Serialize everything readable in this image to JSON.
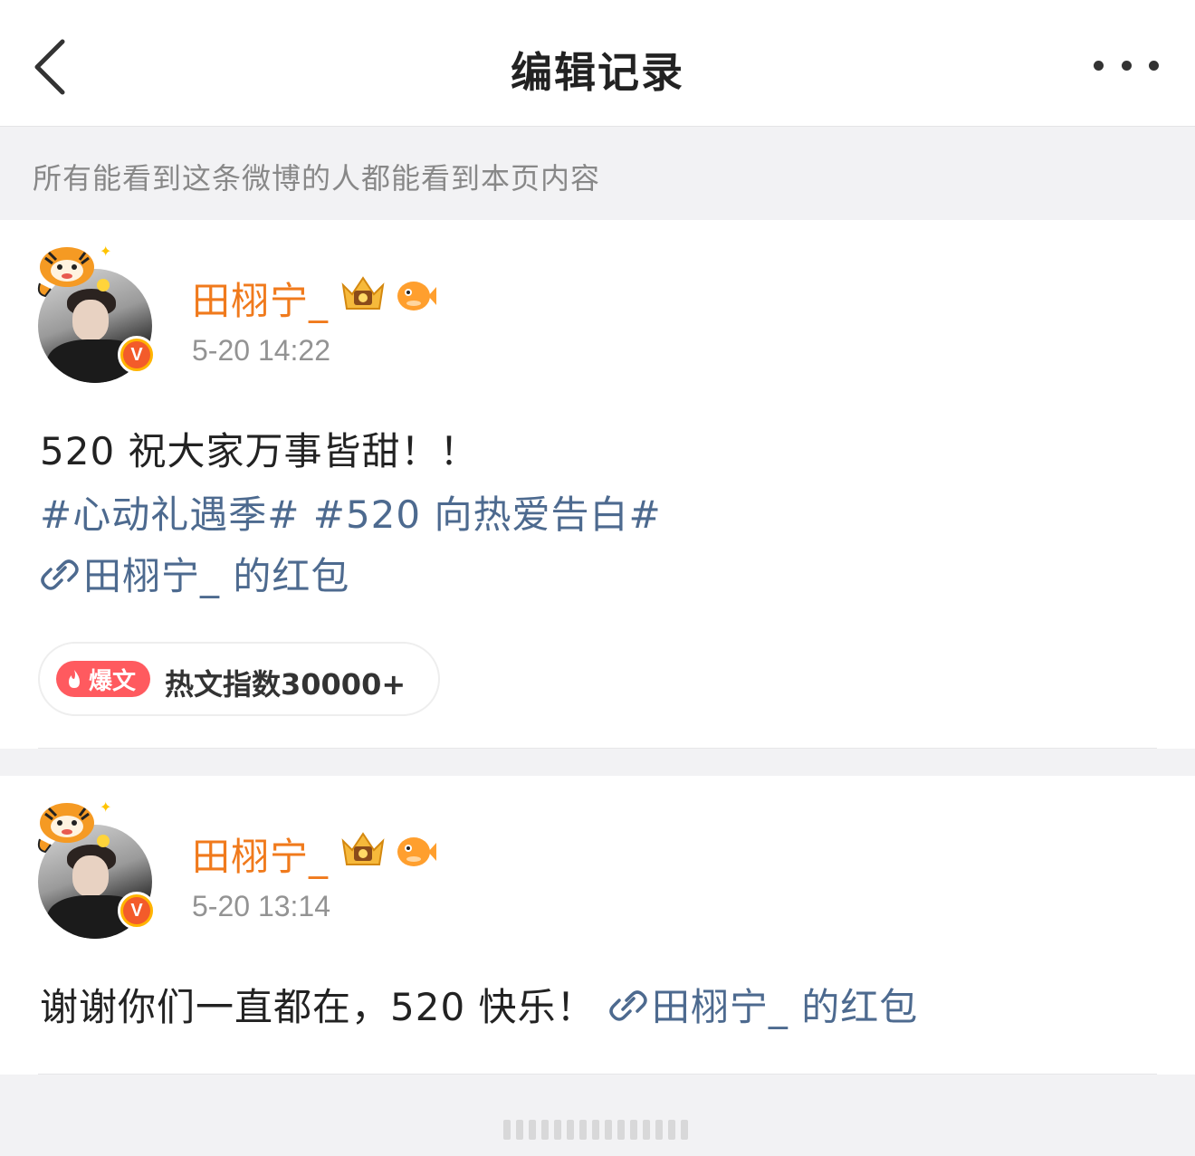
{
  "header": {
    "title": "编辑记录",
    "back_icon": "chevron-left-icon",
    "more_icon": "more-dots-icon"
  },
  "notice": "所有能看到这条微博的人都能看到本页内容",
  "posts": [
    {
      "username": "田栩宁_",
      "timestamp": "5-20 14:22",
      "line1": "520 祝大家万事皆甜！！",
      "hashtag1": "#心动礼遇季#",
      "hashtag2": "#520 向热爱告白#",
      "link": "田栩宁_ 的红包",
      "hot_tag": "爆文",
      "hot_label": "热文指数30000+"
    },
    {
      "username": "田栩宁_",
      "timestamp": "5-20 13:14",
      "text": "谢谢你们一直都在，520 快乐！",
      "link": "田栩宁_ 的红包"
    }
  ],
  "colors": {
    "username": "#f07a1c",
    "link": "#4d6a8f",
    "hot_tag": "#ff5a5f",
    "verified": "#f35b2a"
  }
}
